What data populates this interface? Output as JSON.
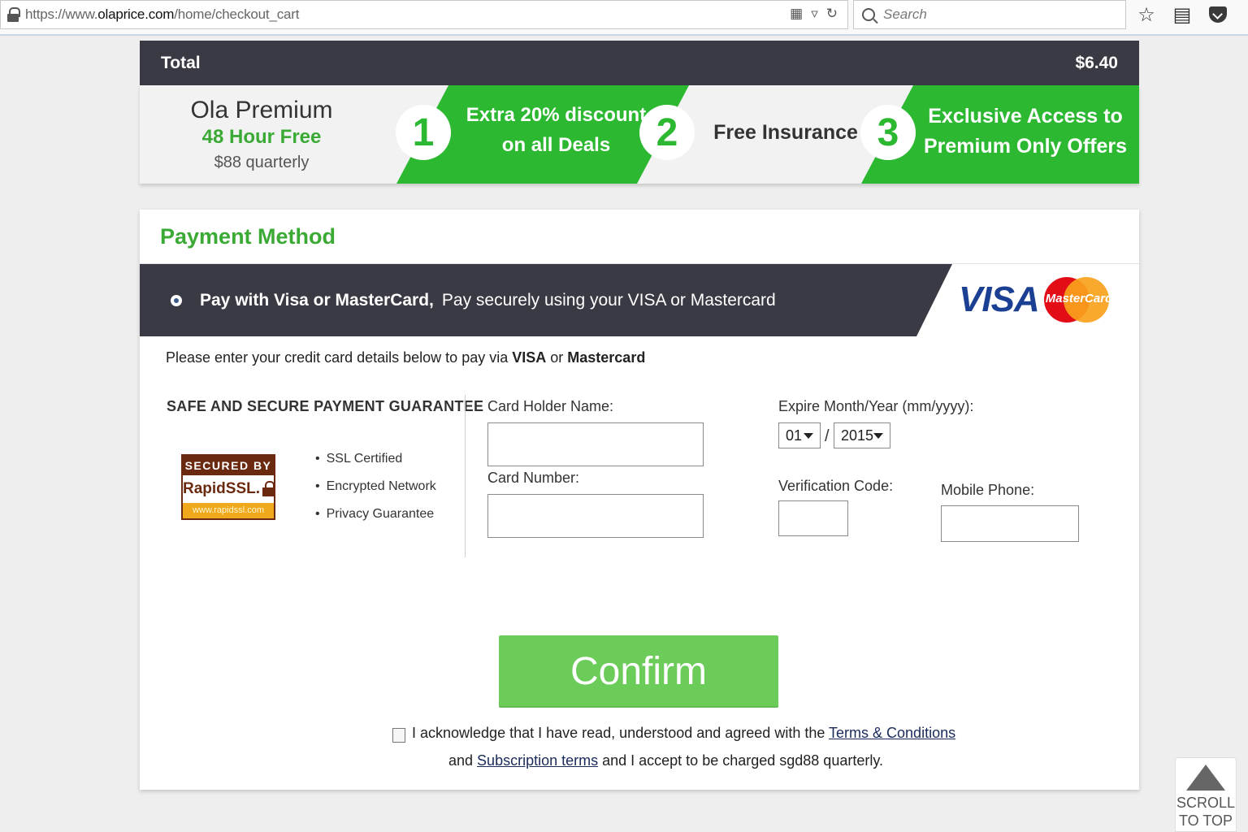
{
  "browser": {
    "url_prefix": "https://www.",
    "url_domain": "olaprice.com",
    "url_path": "/home/checkout_cart",
    "search_placeholder": "Search",
    "icons": [
      "lock-icon",
      "reader-icon",
      "dropdown-icon",
      "reload-icon",
      "search-icon",
      "star-icon",
      "list-icon",
      "pocket-icon"
    ]
  },
  "total": {
    "label": "Total",
    "amount": "$6.40"
  },
  "premium": {
    "title": "Ola Premium",
    "subtitle": "48 Hour Free",
    "price": "$88 quarterly",
    "deals": [
      {
        "number": "1",
        "line1": "Extra 20% discount",
        "line2": "on all Deals"
      },
      {
        "number": "2",
        "line1": "Free Insurance",
        "line2": ""
      },
      {
        "number": "3",
        "line1": "Exclusive Access to",
        "line2": "Premium Only Offers"
      }
    ]
  },
  "payment": {
    "title": "Payment Method",
    "option_label": "Pay with Visa or MasterCard,",
    "option_desc": "Pay securely using your VISA or Mastercard",
    "visa_logo": "VISA",
    "mastercard_logo": "MasterCard",
    "instructions_pre": "Please enter your credit card details below to pay via ",
    "instructions_visa": "VISA",
    "instructions_or": " or ",
    "instructions_mc": "Mastercard",
    "guarantee_title": "SAFE AND SECURE PAYMENT GUARANTEE",
    "ssl_badge": {
      "top": "SECURED BY",
      "brand": "RapidSSL.",
      "url": "www.rapidssl.com"
    },
    "guarantees": [
      "SSL Certified",
      "Encrypted Network",
      "Privacy Guarantee"
    ],
    "fields": {
      "holder_label": "Card Holder Name:",
      "holder_value": "",
      "number_label": "Card Number:",
      "number_value": "",
      "expire_label": "Expire Month/Year (mm/yyyy):",
      "expire_month": "01",
      "expire_separator": "/",
      "expire_year": "2015",
      "cvv_label": "Verification Code:",
      "cvv_value": "",
      "mobile_label": "Mobile Phone:",
      "mobile_value": ""
    },
    "confirm_label": "Confirm",
    "ack_checked": false,
    "ack_text1": "I acknowledge that I have read, understood and agreed with the ",
    "terms_link": "Terms & Conditions",
    "ack_text2a": "and ",
    "subscription_link": "Subscription terms",
    "ack_text2b": " and I accept to be charged sgd88 quarterly."
  },
  "scroll_top": {
    "line1": "SCROLL",
    "line2": "TO TOP"
  },
  "colors": {
    "accent_green": "#2db832",
    "title_green": "#3aaa35",
    "confirm_green": "#6bcc5a",
    "dark_bar": "#3a3a44"
  }
}
